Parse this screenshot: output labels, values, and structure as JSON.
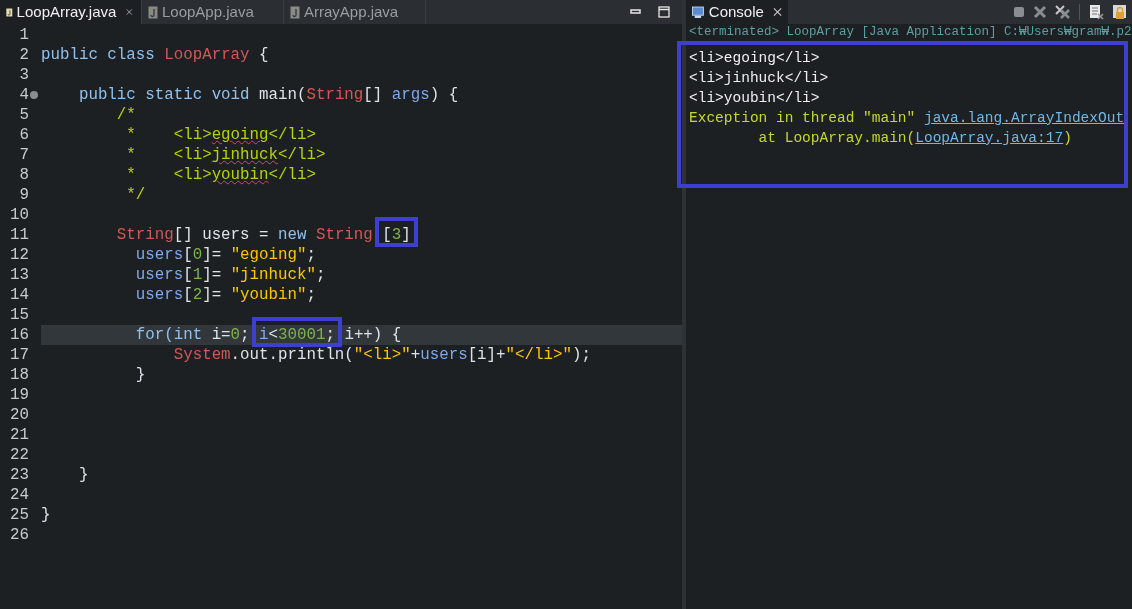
{
  "editor": {
    "tabs": [
      {
        "label": "LoopArray.java",
        "selected": true,
        "closable": true
      },
      {
        "label": "LoopApp.java",
        "selected": false,
        "closable": false
      },
      {
        "label": "ArrayApp.java",
        "selected": false,
        "closable": false
      }
    ],
    "lines": [
      {
        "number": "1",
        "current": false
      },
      {
        "number": "2",
        "current": false,
        "tokens": [
          {
            "text": "public class ",
            "kind": "keyword"
          },
          {
            "text": "LoopArray",
            "kind": "type"
          },
          {
            "text": " {",
            "kind": "plain"
          }
        ]
      },
      {
        "number": "3",
        "current": false
      },
      {
        "number": "4",
        "current": false,
        "fold": true,
        "tokens": [
          {
            "text": "    public static void ",
            "kind": "keyword"
          },
          {
            "text": "main(",
            "kind": "plain"
          },
          {
            "text": "String",
            "kind": "type"
          },
          {
            "text": "[] ",
            "kind": "plain"
          },
          {
            "text": "args",
            "kind": "variable"
          },
          {
            "text": ") {",
            "kind": "plain"
          }
        ]
      },
      {
        "number": "5",
        "current": false,
        "tokens": [
          {
            "text": "        /*",
            "kind": "comment"
          }
        ]
      },
      {
        "number": "6",
        "current": false,
        "tokens": [
          {
            "text": "         *    <li>",
            "kind": "comment"
          },
          {
            "text": "egoing",
            "kind": "comment",
            "misspelled": true
          },
          {
            "text": "</li>",
            "kind": "comment"
          }
        ]
      },
      {
        "number": "7",
        "current": false,
        "tokens": [
          {
            "text": "         *    <li>",
            "kind": "comment"
          },
          {
            "text": "jinhuck",
            "kind": "comment",
            "misspelled": true
          },
          {
            "text": "</li>",
            "kind": "comment"
          }
        ]
      },
      {
        "number": "8",
        "current": false,
        "tokens": [
          {
            "text": "         *    <li>",
            "kind": "comment"
          },
          {
            "text": "youbin",
            "kind": "comment",
            "misspelled": true
          },
          {
            "text": "</li>",
            "kind": "comment"
          }
        ]
      },
      {
        "number": "9",
        "current": false,
        "tokens": [
          {
            "text": "         */",
            "kind": "comment"
          }
        ]
      },
      {
        "number": "10",
        "current": false
      },
      {
        "number": "11",
        "current": false,
        "tokens": [
          {
            "text": "        String",
            "kind": "type"
          },
          {
            "text": "[] users = ",
            "kind": "plain"
          },
          {
            "text": "new ",
            "kind": "keyword"
          },
          {
            "text": "String ",
            "kind": "type"
          },
          {
            "text": "[",
            "kind": "plain",
            "boxed": true
          },
          {
            "text": "3",
            "kind": "number",
            "boxed": true
          },
          {
            "text": "]",
            "kind": "plain",
            "boxed": true
          }
        ]
      },
      {
        "number": "12",
        "current": false,
        "tokens": [
          {
            "text": "          users",
            "kind": "variable"
          },
          {
            "text": "[",
            "kind": "plain"
          },
          {
            "text": "0",
            "kind": "number"
          },
          {
            "text": "]= ",
            "kind": "plain"
          },
          {
            "text": "\"egoing\"",
            "kind": "string"
          },
          {
            "text": ";",
            "kind": "plain"
          }
        ]
      },
      {
        "number": "13",
        "current": false,
        "tokens": [
          {
            "text": "          users",
            "kind": "variable"
          },
          {
            "text": "[",
            "kind": "plain"
          },
          {
            "text": "1",
            "kind": "number"
          },
          {
            "text": "]= ",
            "kind": "plain"
          },
          {
            "text": "\"jinhuck\"",
            "kind": "string"
          },
          {
            "text": ";",
            "kind": "plain"
          }
        ]
      },
      {
        "number": "14",
        "current": false,
        "tokens": [
          {
            "text": "          users",
            "kind": "variable"
          },
          {
            "text": "[",
            "kind": "plain"
          },
          {
            "text": "2",
            "kind": "number"
          },
          {
            "text": "]= ",
            "kind": "plain"
          },
          {
            "text": "\"youbin\"",
            "kind": "string"
          },
          {
            "text": ";",
            "kind": "plain"
          }
        ]
      },
      {
        "number": "15",
        "current": false
      },
      {
        "number": "16",
        "current": true,
        "tokens": [
          {
            "text": "          for(int ",
            "kind": "keyword"
          },
          {
            "text": "i=",
            "kind": "plain"
          },
          {
            "text": "0",
            "kind": "number"
          },
          {
            "text": "; ",
            "kind": "plain"
          },
          {
            "text": "i",
            "kind": "variable",
            "boxed": true
          },
          {
            "text": "<",
            "kind": "plain",
            "boxed": true
          },
          {
            "text": "30001",
            "kind": "number",
            "boxed": true
          },
          {
            "text": ";",
            "kind": "plain",
            "boxed": true
          },
          {
            "text": " i++) {",
            "kind": "plain"
          }
        ]
      },
      {
        "number": "17",
        "current": false,
        "tokens": [
          {
            "text": "              System",
            "kind": "type"
          },
          {
            "text": ".out.println(",
            "kind": "plain"
          },
          {
            "text": "\"<li>\"",
            "kind": "string"
          },
          {
            "text": "+",
            "kind": "plain"
          },
          {
            "text": "users",
            "kind": "variable"
          },
          {
            "text": "[i]+",
            "kind": "plain"
          },
          {
            "text": "\"</li>\"",
            "kind": "string"
          },
          {
            "text": ");",
            "kind": "plain"
          }
        ]
      },
      {
        "number": "18",
        "current": false,
        "tokens": [
          {
            "text": "          }",
            "kind": "plain"
          }
        ]
      },
      {
        "number": "19",
        "current": false
      },
      {
        "number": "20",
        "current": false
      },
      {
        "number": "21",
        "current": false
      },
      {
        "number": "22",
        "current": false
      },
      {
        "number": "23",
        "current": false,
        "tokens": [
          {
            "text": "    }",
            "kind": "plain"
          }
        ]
      },
      {
        "number": "24",
        "current": false
      },
      {
        "number": "25",
        "current": false,
        "tokens": [
          {
            "text": "}",
            "kind": "plain"
          }
        ]
      },
      {
        "number": "26",
        "current": false
      }
    ]
  },
  "console": {
    "tab": {
      "label": "Console",
      "selected": true
    },
    "status": "<terminated> LoopArray [Java Application] C:₩Users₩gram₩.p2",
    "boxed": true,
    "lines": [
      {
        "kind": "output",
        "segments": [
          {
            "text": "<li>egoing</li>",
            "link": false
          }
        ]
      },
      {
        "kind": "output",
        "segments": [
          {
            "text": "<li>jinhuck</li>",
            "link": false
          }
        ]
      },
      {
        "kind": "output",
        "segments": [
          {
            "text": "<li>youbin</li>",
            "link": false
          }
        ]
      },
      {
        "kind": "error",
        "segments": [
          {
            "text": "Exception in thread \"main\" ",
            "link": false
          },
          {
            "text": "java.lang.ArrayIndexOut",
            "link": true
          }
        ]
      },
      {
        "kind": "error",
        "segments": [
          {
            "text": "        at LoopArray.main(",
            "link": false
          },
          {
            "text": "LoopArray.java:17",
            "link": true
          },
          {
            "text": ")",
            "link": false
          }
        ]
      }
    ]
  }
}
